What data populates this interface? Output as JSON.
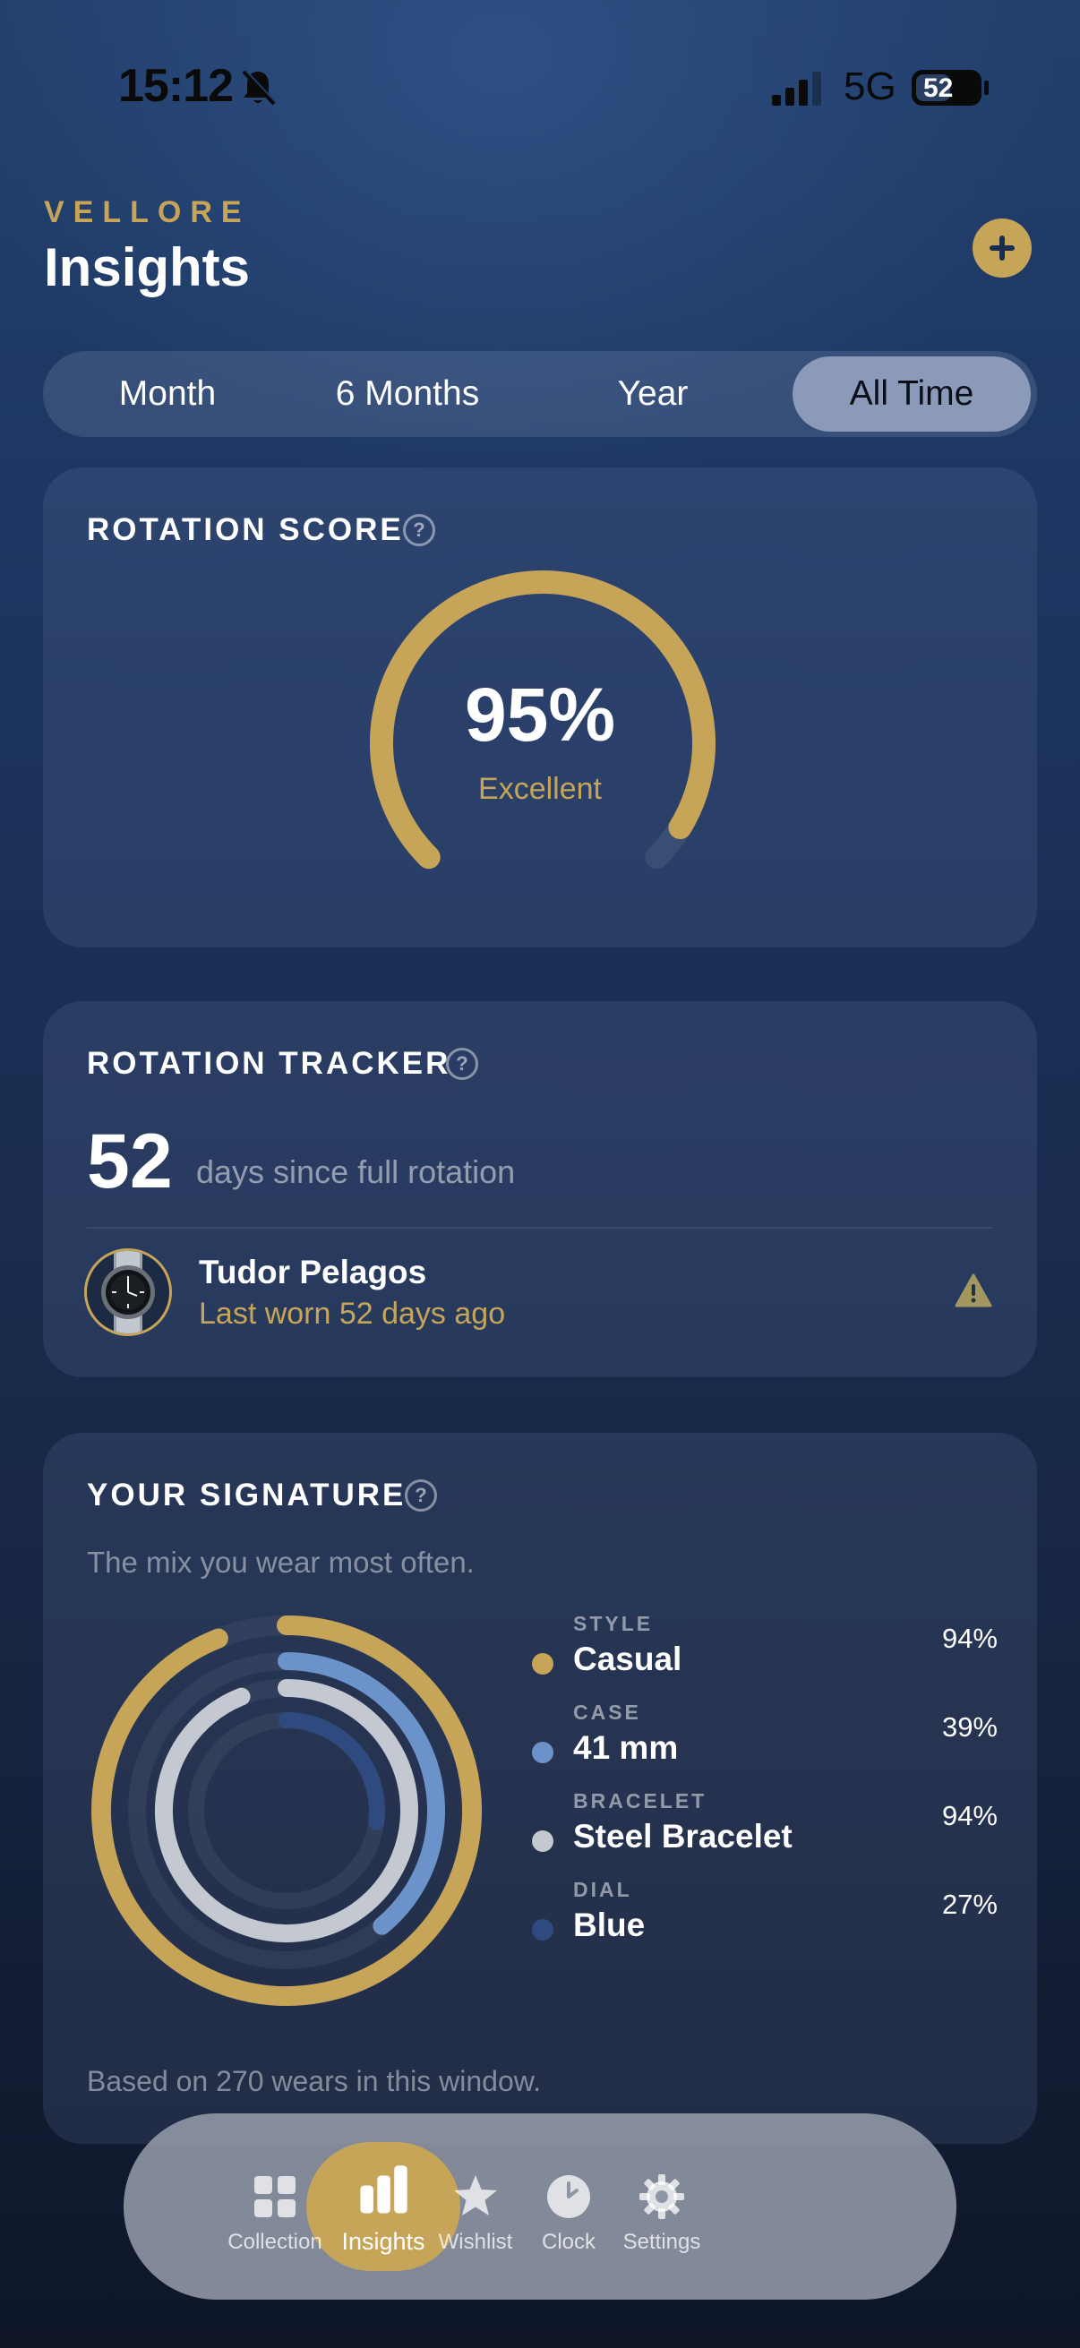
{
  "status_bar": {
    "time": "15:12",
    "network": "5G",
    "battery": "52"
  },
  "header": {
    "brand": "VELLORE",
    "title": "Insights"
  },
  "segments": [
    {
      "label": "Month",
      "active": false
    },
    {
      "label": "6 Months",
      "active": false
    },
    {
      "label": "Year",
      "active": false
    },
    {
      "label": "All Time",
      "active": true
    }
  ],
  "rotation_score": {
    "title": "ROTATION SCORE",
    "value": "95%",
    "label": "Excellent",
    "fraction": 0.95
  },
  "rotation_tracker": {
    "title": "ROTATION TRACKER",
    "count": "52",
    "count_text": "days since full rotation",
    "watch_name": "Tudor Pelagos",
    "watch_subtitle": "Last worn 52 days ago"
  },
  "signature": {
    "title": "YOUR SIGNATURE",
    "subtitle": "The mix you wear most often.",
    "items": [
      {
        "category": "STYLE",
        "value": "Casual",
        "percent": "94%",
        "fraction": 0.94,
        "color": "#c7a558"
      },
      {
        "category": "CASE",
        "value": "41 mm",
        "percent": "39%",
        "fraction": 0.39,
        "color": "#6b93c9"
      },
      {
        "category": "BRACELET",
        "value": "Steel Bracelet",
        "percent": "94%",
        "fraction": 0.94,
        "color": "#c3c8d1"
      },
      {
        "category": "DIAL",
        "value": "Blue",
        "percent": "27%",
        "fraction": 0.27,
        "color": "#2f4a7f"
      }
    ],
    "footer": "Based on 270 wears in this window."
  },
  "tab_bar": [
    {
      "label": "Collection",
      "icon": "grid-icon",
      "active": false
    },
    {
      "label": "Insights",
      "icon": "bar-chart-icon",
      "active": true
    },
    {
      "label": "Wishlist",
      "icon": "star-icon",
      "active": false
    },
    {
      "label": "Clock",
      "icon": "clock-icon",
      "active": false
    },
    {
      "label": "Settings",
      "icon": "gear-icon",
      "active": false
    }
  ],
  "colors": {
    "accent": "#c7a558",
    "background": "#1d3560"
  }
}
